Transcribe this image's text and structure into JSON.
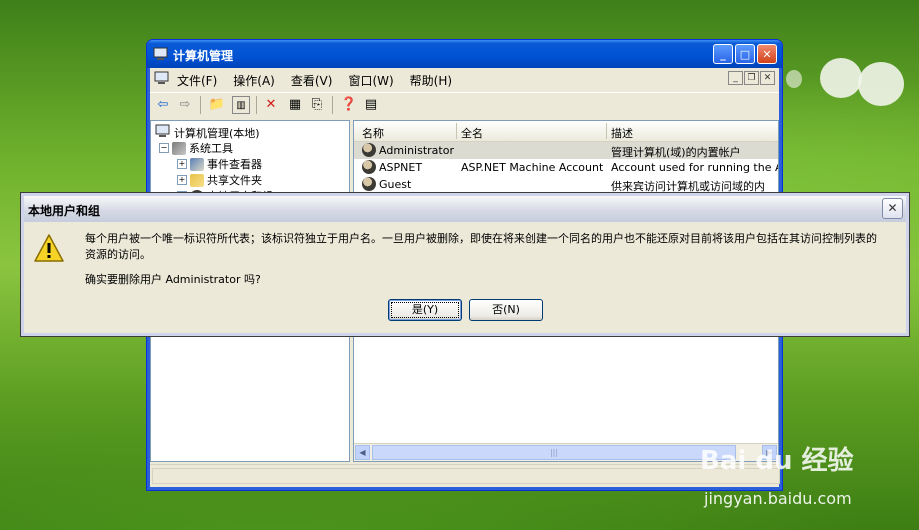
{
  "window": {
    "title": "计算机管理",
    "menus": [
      "文件(F)",
      "操作(A)",
      "查看(V)",
      "窗口(W)",
      "帮助(H)"
    ]
  },
  "tree": {
    "root": "计算机管理(本地)",
    "system_tools": "系统工具",
    "event_viewer": "事件查看器",
    "shared_folders": "共享文件夹",
    "local_users": "本地用户和组"
  },
  "list": {
    "columns": [
      "名称",
      "全名",
      "描述"
    ],
    "rows": [
      {
        "name": "Administrator",
        "fullname": "",
        "desc": "管理计算机(域)的内置帐户"
      },
      {
        "name": "ASPNET",
        "fullname": "ASP.NET Machine Account",
        "desc": "Account used for running the ASP.I"
      },
      {
        "name": "Guest",
        "fullname": "",
        "desc": "供来宾访问计算机或访问域的内"
      }
    ]
  },
  "dialog": {
    "title": "本地用户和组",
    "message": "每个用户被一个唯一标识符所代表；该标识符独立于用户名。一旦用户被删除，即使在将来创建一个同名的用户也不能还原对目前将该用户包括在其访问控制列表的资源的访问。",
    "question": "确实要删除用户 Administrator 吗?",
    "yes": "是(Y)",
    "no": "否(N)"
  },
  "watermark": {
    "brand": "Bai du 经验",
    "url": "jingyan.baidu.com"
  }
}
